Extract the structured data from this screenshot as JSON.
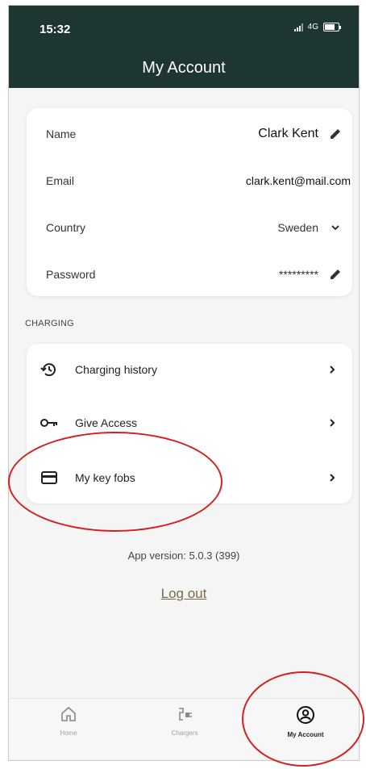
{
  "status_bar": {
    "time": "15:32",
    "network": "4G"
  },
  "header": {
    "title": "My Account"
  },
  "profile": {
    "name_label": "Name",
    "name_value": "Clark Kent",
    "email_label": "Email",
    "email_value": "clark.kent@mail.com",
    "country_label": "Country",
    "country_value": "Sweden",
    "password_label": "Password",
    "password_value": "*********"
  },
  "charging": {
    "section_label": "CHARGING",
    "items": [
      {
        "label": "Charging history",
        "icon": "history-icon"
      },
      {
        "label": "Give Access",
        "icon": "key-icon"
      },
      {
        "label": "My key fobs",
        "icon": "card-icon"
      }
    ]
  },
  "app_version": "App version: 5.0.3 (399)",
  "logout_label": "Log out",
  "tabbar": {
    "items": [
      {
        "label": "Home",
        "icon": "home-icon",
        "active": false
      },
      {
        "label": "Chargers",
        "icon": "charger-icon",
        "active": false
      },
      {
        "label": "My Account",
        "icon": "account-icon",
        "active": true
      }
    ]
  },
  "colors": {
    "header_bg": "#1e3631",
    "annotation": "#d42020",
    "logout": "#7a6a4a"
  }
}
